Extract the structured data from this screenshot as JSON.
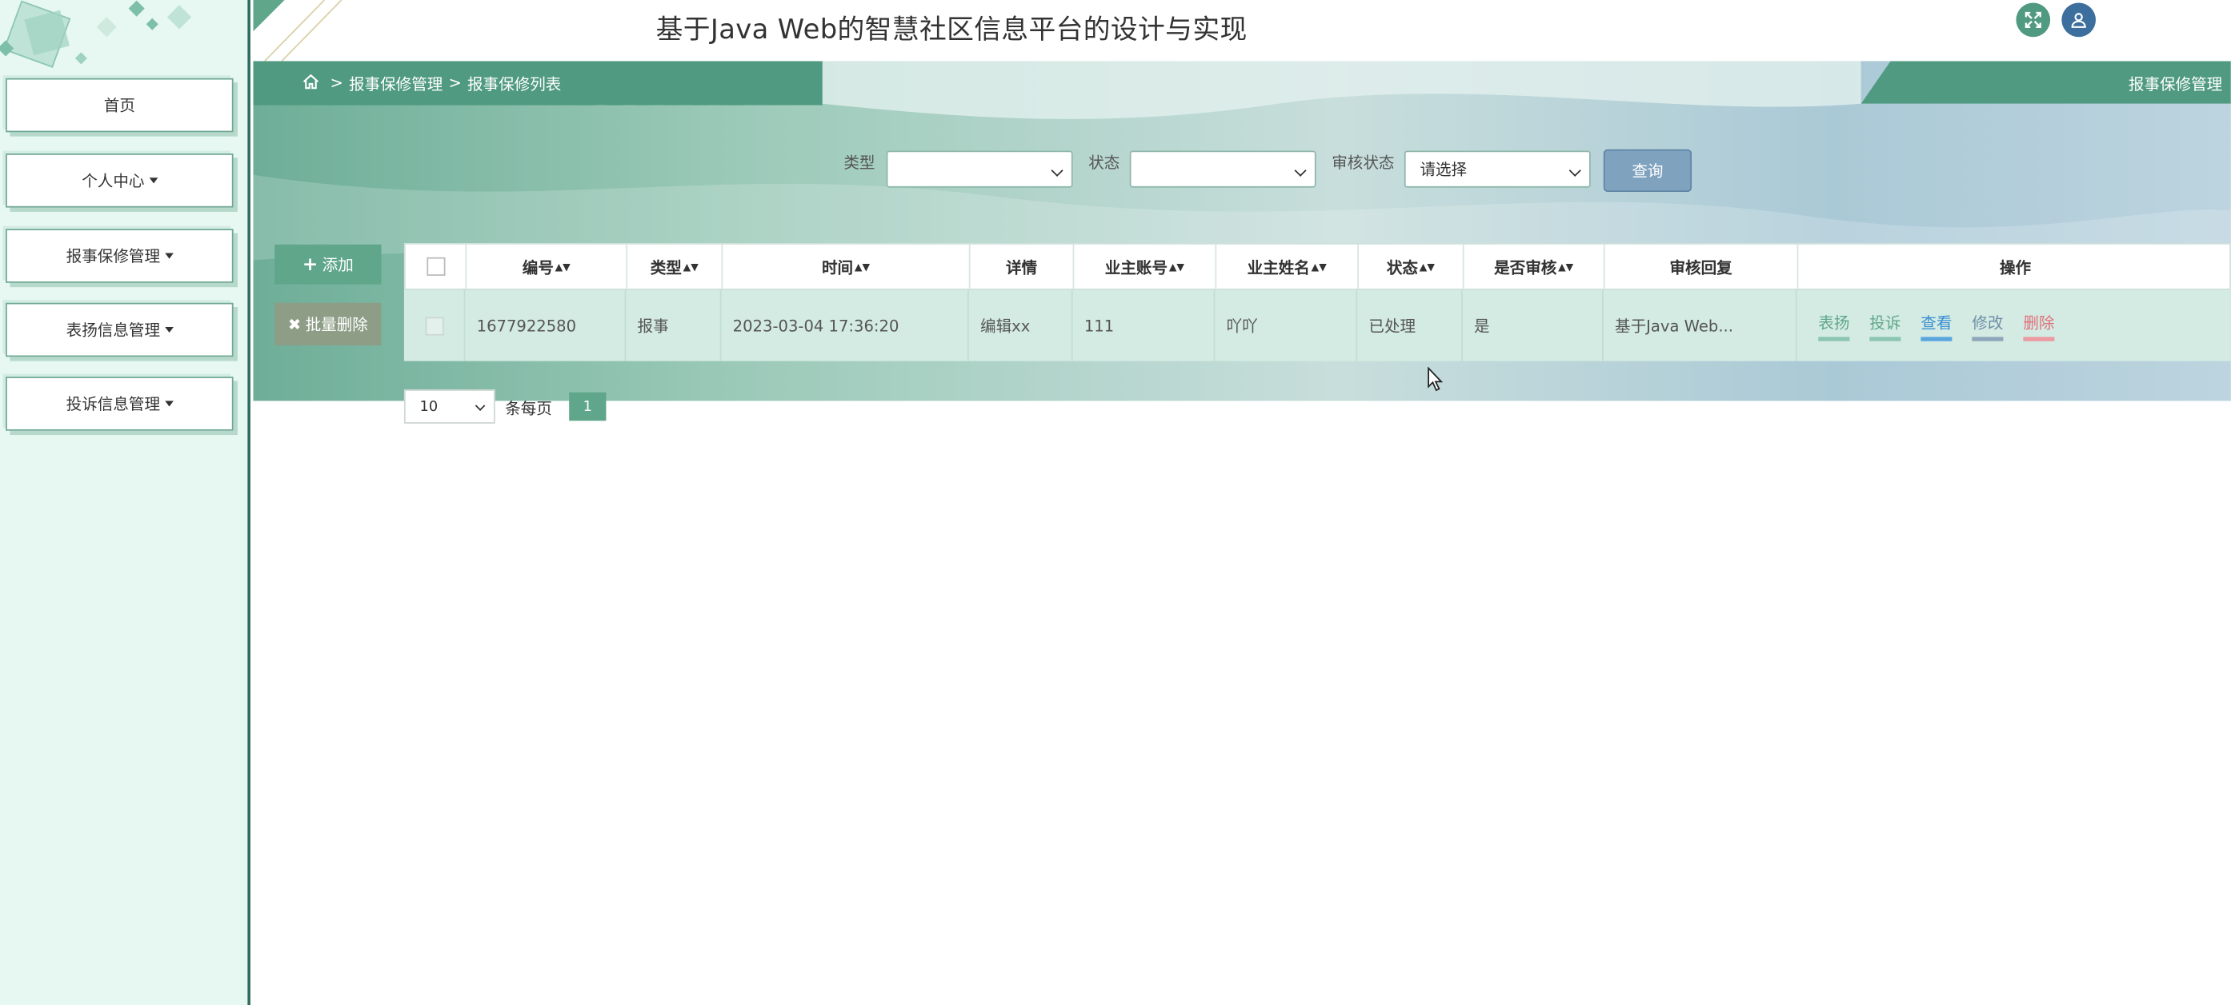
{
  "app": {
    "title": "基于Java Web的智慧社区信息平台的设计与实现"
  },
  "sidebar": {
    "items": [
      {
        "label": "首页",
        "dropdown": false
      },
      {
        "label": "个人中心",
        "dropdown": true
      },
      {
        "label": "报事保修管理",
        "dropdown": true
      },
      {
        "label": "表扬信息管理",
        "dropdown": true
      },
      {
        "label": "投诉信息管理",
        "dropdown": true
      }
    ]
  },
  "header": {
    "fullscreen_icon": "expand-icon",
    "user_icon": "user-icon"
  },
  "breadcrumb": {
    "home_icon": "home-icon",
    "sep1": ">",
    "level1": "报事保修管理",
    "sep2": ">",
    "level2": "报事保修列表"
  },
  "right_tab": {
    "label": "报事保修管理"
  },
  "search": {
    "type_label": "类型",
    "type_value": "",
    "status_label": "状态",
    "status_value": "",
    "review_label": "审核状态",
    "review_value": "请选择",
    "query_button": "查询"
  },
  "actions": {
    "add": "添加",
    "batch_delete": "批量删除"
  },
  "table": {
    "headers": [
      "编号",
      "类型",
      "时间",
      "详情",
      "业主账号",
      "业主姓名",
      "状态",
      "是否审核",
      "审核回复",
      "操作"
    ],
    "rows": [
      {
        "id": "1677922580",
        "type": "报事",
        "time": "2023-03-04 17:36:20",
        "detail": "编辑xx",
        "account": "111",
        "name": "吖吖",
        "status": "已处理",
        "reviewed": "是",
        "reply": "基于Java Web..."
      }
    ],
    "operations": [
      {
        "label": "表扬",
        "color": "#5fa68b"
      },
      {
        "label": "投诉",
        "color": "#5fa68b"
      },
      {
        "label": "查看",
        "color": "#3a8fd1"
      },
      {
        "label": "修改",
        "color": "#6f8fa8"
      },
      {
        "label": "删除",
        "color": "#e0707a"
      }
    ]
  },
  "pagination": {
    "page_size": "10",
    "per_page_label": "条每页",
    "current_page": "1"
  }
}
